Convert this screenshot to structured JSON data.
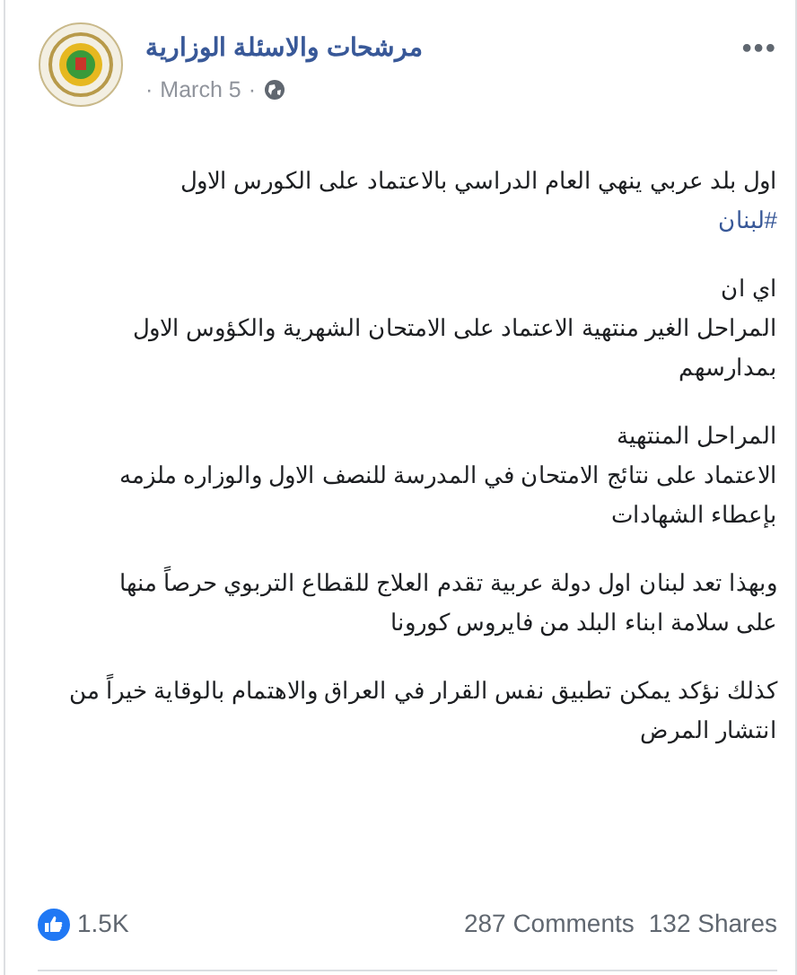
{
  "post": {
    "author": "مرشحات والاسئلة الوزارية",
    "more": "•••",
    "separator": "·",
    "date": "March 5",
    "headline": "اول بلد عربي ينهي العام الدراسي بالاعتماد على الكورس الاول",
    "hashtag": "#لبنان",
    "paragraphs": [
      [
        "اي ان",
        "المراحل الغير منتهية الاعتماد على الامتحان الشهرية والكؤوس الاول",
        "بمدارسهم"
      ],
      [
        "المراحل المنتهية",
        "الاعتماد على نتائج الامتحان في المدرسة للنصف الاول والوزاره ملزمه",
        "بإعطاء الشهادات"
      ],
      [
        "وبهذا تعد لبنان اول دولة عربية تقدم العلاج للقطاع التربوي حرصاً منها",
        "على سلامة ابناء البلد من فايروس كورونا"
      ],
      [
        "كذلك نؤكد يمكن تطبيق نفس القرار في العراق والاهتمام بالوقاية خيراً من",
        "انتشار المرض"
      ]
    ]
  },
  "footer": {
    "likes": "1.5K",
    "comments": "287 Comments",
    "shares": "132 Shares"
  }
}
